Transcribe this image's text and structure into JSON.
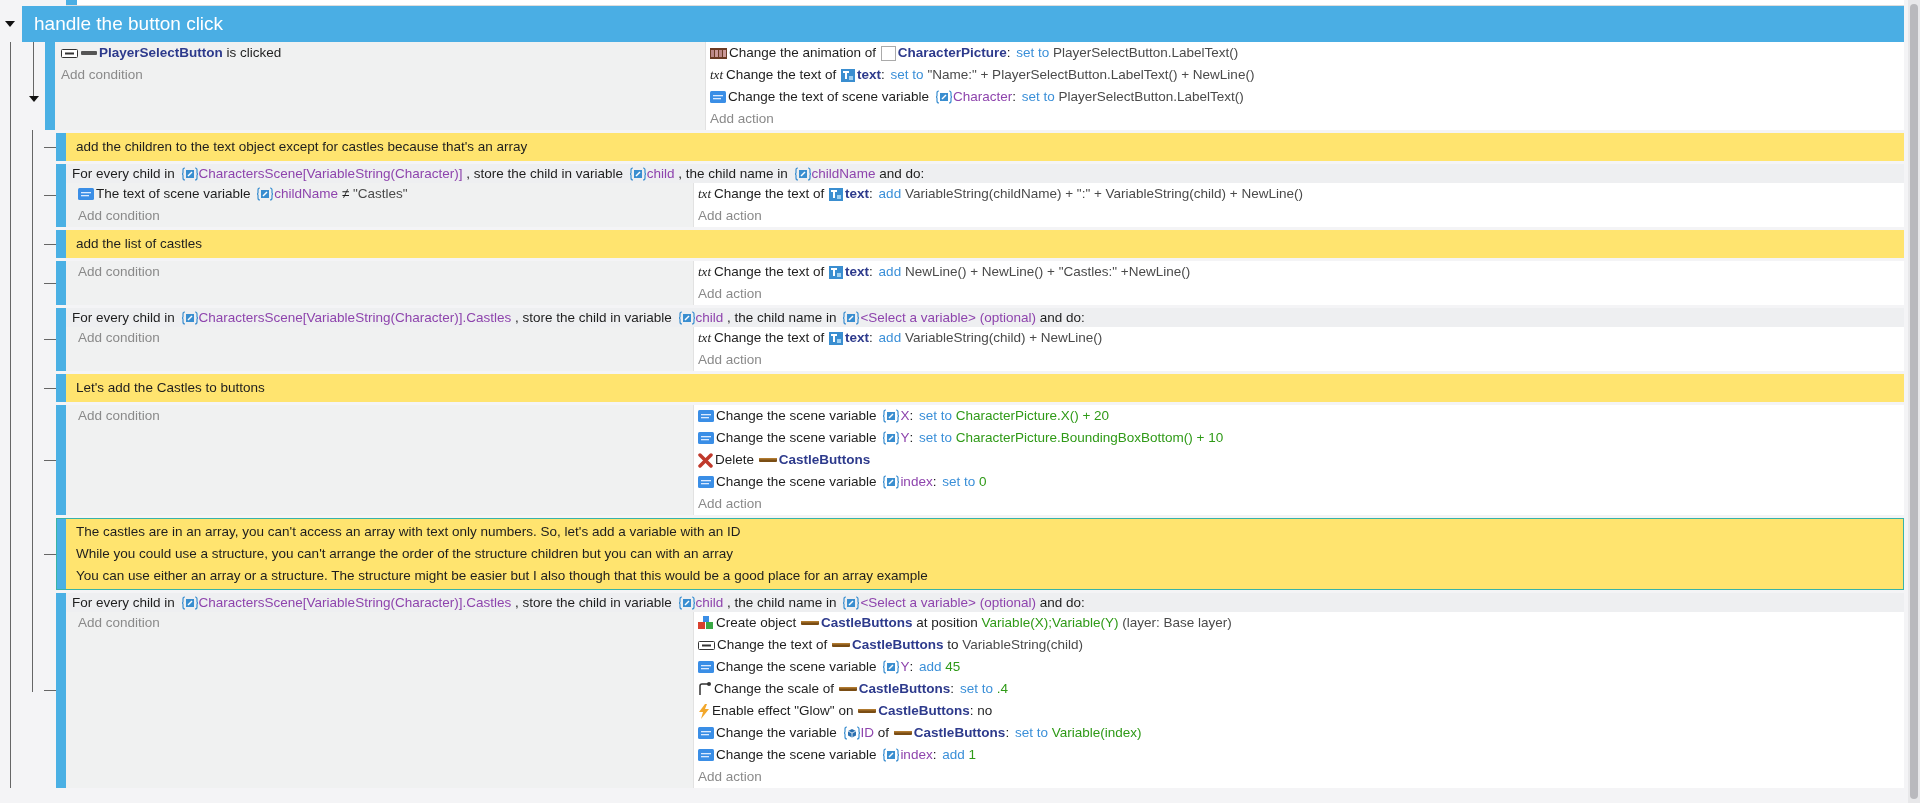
{
  "group": {
    "title": "handle the button click",
    "expanded": true
  },
  "events": [
    {
      "kind": "standard",
      "selected": false,
      "expanded": true,
      "conditions": [
        {
          "kind": "button",
          "parts": [
            {
              "kind": "button-object",
              "text": "PlayerSelectButton"
            },
            {
              "kind": "plain",
              "text": " is clicked"
            }
          ]
        }
      ],
      "add_condition": "Add condition",
      "actions": [
        {
          "kind": "animation",
          "parts": [
            {
              "kind": "plain",
              "text": "Change the animation of "
            },
            {
              "kind": "sprite-object",
              "text": "CharacterPicture"
            },
            {
              "kind": "plain",
              "text": ": "
            },
            {
              "kind": "op",
              "text": "set to "
            },
            {
              "kind": "expr",
              "text": "PlayerSelectButton.LabelText()"
            }
          ]
        },
        {
          "kind": "text",
          "glyph": "txt",
          "parts": [
            {
              "kind": "plain",
              "text": "Change the text of "
            },
            {
              "kind": "text-object",
              "text": "text"
            },
            {
              "kind": "plain",
              "text": ": "
            },
            {
              "kind": "op",
              "text": "set to "
            },
            {
              "kind": "expr",
              "text": "\"Name:\" + PlayerSelectButton.LabelText() + NewLine()"
            }
          ]
        },
        {
          "kind": "variable",
          "parts": [
            {
              "kind": "plain",
              "text": "Change the text of scene variable "
            },
            {
              "kind": "scene-variable",
              "text": "Character"
            },
            {
              "kind": "plain",
              "text": ": "
            },
            {
              "kind": "op",
              "text": "set to "
            },
            {
              "kind": "expr",
              "text": "PlayerSelectButton.LabelText()"
            }
          ]
        }
      ],
      "add_action": "Add action",
      "children": [
        {
          "kind": "comment",
          "selected": false,
          "lines": [
            "add the children to the text object except for castles because that's an array"
          ]
        },
        {
          "kind": "for-each",
          "selected": false,
          "header": [
            {
              "kind": "plain",
              "text": "For every child in "
            },
            {
              "kind": "scene-variable",
              "text": "CharactersScene[VariableString(Character)]"
            },
            {
              "kind": "plain",
              "text": " , store the child in variable "
            },
            {
              "kind": "scene-variable",
              "text": "child"
            },
            {
              "kind": "plain",
              "text": " , the child name in "
            },
            {
              "kind": "scene-variable",
              "text": "childName"
            },
            {
              "kind": "plain",
              "text": " and do:"
            }
          ],
          "conditions": [
            {
              "kind": "variable",
              "parts": [
                {
                  "kind": "plain",
                  "text": "The text of scene variable "
                },
                {
                  "kind": "scene-variable",
                  "text": "childName"
                },
                {
                  "kind": "plain",
                  "text": " ≠ "
                },
                {
                  "kind": "expr",
                  "text": "\"Castles\""
                }
              ]
            }
          ],
          "add_condition": "Add condition",
          "actions": [
            {
              "kind": "text",
              "glyph": "txt",
              "parts": [
                {
                  "kind": "plain",
                  "text": "Change the text of "
                },
                {
                  "kind": "text-object",
                  "text": "text"
                },
                {
                  "kind": "plain",
                  "text": ": "
                },
                {
                  "kind": "op",
                  "text": "add "
                },
                {
                  "kind": "expr",
                  "text": "VariableString(childName) + \":\" + VariableString(child) + NewLine()"
                }
              ]
            }
          ],
          "add_action": "Add action"
        },
        {
          "kind": "comment",
          "selected": false,
          "lines": [
            "add the list of castles"
          ]
        },
        {
          "kind": "standard",
          "selected": false,
          "add_condition": "Add condition",
          "actions": [
            {
              "kind": "text",
              "glyph": "txt",
              "parts": [
                {
                  "kind": "plain",
                  "text": "Change the text of "
                },
                {
                  "kind": "text-object",
                  "text": "text"
                },
                {
                  "kind": "plain",
                  "text": ": "
                },
                {
                  "kind": "op",
                  "text": "add "
                },
                {
                  "kind": "expr",
                  "text": "NewLine() + NewLine() + \"Castles:\" +NewLine()"
                }
              ]
            }
          ],
          "add_action": "Add action"
        },
        {
          "kind": "for-each",
          "selected": false,
          "header": [
            {
              "kind": "plain",
              "text": "For every child in "
            },
            {
              "kind": "scene-variable",
              "text": "CharactersScene[VariableString(Character)].Castles"
            },
            {
              "kind": "plain",
              "text": " , store the child in variable "
            },
            {
              "kind": "scene-variable",
              "text": "child"
            },
            {
              "kind": "plain",
              "text": " , the child name in "
            },
            {
              "kind": "scene-variable",
              "text": "<Select a variable> (optional)"
            },
            {
              "kind": "plain",
              "text": " and do:"
            }
          ],
          "add_condition": "Add condition",
          "actions": [
            {
              "kind": "text",
              "glyph": "txt",
              "parts": [
                {
                  "kind": "plain",
                  "text": "Change the text of "
                },
                {
                  "kind": "text-object",
                  "text": "text"
                },
                {
                  "kind": "plain",
                  "text": ": "
                },
                {
                  "kind": "op",
                  "text": "add "
                },
                {
                  "kind": "expr",
                  "text": "VariableString(child) + NewLine()"
                }
              ]
            }
          ],
          "add_action": "Add action"
        },
        {
          "kind": "comment",
          "selected": false,
          "lines": [
            "Let's add the Castles to buttons"
          ]
        },
        {
          "kind": "standard",
          "selected": false,
          "add_condition": "Add condition",
          "actions": [
            {
              "kind": "variable",
              "parts": [
                {
                  "kind": "plain",
                  "text": "Change the scene variable "
                },
                {
                  "kind": "scene-variable",
                  "text": "X"
                },
                {
                  "kind": "plain",
                  "text": ": "
                },
                {
                  "kind": "op",
                  "text": "set to "
                },
                {
                  "kind": "value",
                  "text": "CharacterPicture.X() + 20"
                }
              ]
            },
            {
              "kind": "variable",
              "parts": [
                {
                  "kind": "plain",
                  "text": "Change the scene variable "
                },
                {
                  "kind": "scene-variable",
                  "text": "Y"
                },
                {
                  "kind": "plain",
                  "text": ": "
                },
                {
                  "kind": "op",
                  "text": "set to "
                },
                {
                  "kind": "value",
                  "text": "CharacterPicture.BoundingBoxBottom() + 10"
                }
              ]
            },
            {
              "kind": "delete",
              "parts": [
                {
                  "kind": "plain",
                  "text": "Delete "
                },
                {
                  "kind": "panel-object",
                  "text": "CastleButtons"
                }
              ]
            },
            {
              "kind": "variable",
              "parts": [
                {
                  "kind": "plain",
                  "text": "Change the scene variable "
                },
                {
                  "kind": "scene-variable",
                  "text": "index"
                },
                {
                  "kind": "plain",
                  "text": ": "
                },
                {
                  "kind": "op",
                  "text": "set to "
                },
                {
                  "kind": "value",
                  "text": "0"
                }
              ]
            }
          ],
          "add_action": "Add action"
        },
        {
          "kind": "comment",
          "selected": true,
          "lines": [
            "The castles are in an array, you can't access an array with text only numbers. So, let's add a variable with an ID",
            "While you could use a structure, you can't arrange the order of the structure children but you can with an array",
            "You can use either an array or a structure. The structure might be easier but I also though that this would be a good place for an array example"
          ]
        },
        {
          "kind": "for-each",
          "selected": false,
          "header": [
            {
              "kind": "plain",
              "text": "For every child in "
            },
            {
              "kind": "scene-variable",
              "text": "CharactersScene[VariableString(Character)].Castles"
            },
            {
              "kind": "plain",
              "text": " , store the child in variable "
            },
            {
              "kind": "scene-variable",
              "text": "child"
            },
            {
              "kind": "plain",
              "text": " , the child name in "
            },
            {
              "kind": "scene-variable",
              "text": "<Select a variable> (optional)"
            },
            {
              "kind": "plain",
              "text": " and do:"
            }
          ],
          "add_condition": "Add condition",
          "actions": [
            {
              "kind": "create",
              "parts": [
                {
                  "kind": "plain",
                  "text": "Create object "
                },
                {
                  "kind": "panel-object",
                  "text": "CastleButtons"
                },
                {
                  "kind": "plain",
                  "text": " at position "
                },
                {
                  "kind": "value",
                  "text": "Variable(X);Variable(Y)"
                },
                {
                  "kind": "expr",
                  "text": " (layer: Base layer)"
                }
              ]
            },
            {
              "kind": "button",
              "parts": [
                {
                  "kind": "plain",
                  "text": "Change the text of "
                },
                {
                  "kind": "panel-object",
                  "text": "CastleButtons"
                },
                {
                  "kind": "plain",
                  "text": " to "
                },
                {
                  "kind": "expr",
                  "text": "VariableString(child)"
                }
              ]
            },
            {
              "kind": "variable",
              "parts": [
                {
                  "kind": "plain",
                  "text": "Change the scene variable "
                },
                {
                  "kind": "scene-variable",
                  "text": "Y"
                },
                {
                  "kind": "plain",
                  "text": ": "
                },
                {
                  "kind": "op",
                  "text": "add "
                },
                {
                  "kind": "value",
                  "text": "45"
                }
              ]
            },
            {
              "kind": "scale",
              "parts": [
                {
                  "kind": "plain",
                  "text": "Change the scale of "
                },
                {
                  "kind": "panel-object",
                  "text": "CastleButtons"
                },
                {
                  "kind": "plain",
                  "text": ": "
                },
                {
                  "kind": "op",
                  "text": "set to "
                },
                {
                  "kind": "value",
                  "text": ".4"
                }
              ]
            },
            {
              "kind": "effect",
              "parts": [
                {
                  "kind": "plain",
                  "text": "Enable effect \"Glow\" on "
                },
                {
                  "kind": "panel-object",
                  "text": "CastleButtons"
                },
                {
                  "kind": "plain",
                  "text": ": no"
                }
              ]
            },
            {
              "kind": "variable",
              "parts": [
                {
                  "kind": "plain",
                  "text": "Change the variable "
                },
                {
                  "kind": "object-variable",
                  "text": "ID"
                },
                {
                  "kind": "plain",
                  "text": " of "
                },
                {
                  "kind": "panel-object",
                  "text": "CastleButtons"
                },
                {
                  "kind": "plain",
                  "text": ": "
                },
                {
                  "kind": "op",
                  "text": "set to "
                },
                {
                  "kind": "value",
                  "text": "Variable(index)"
                }
              ]
            },
            {
              "kind": "variable",
              "parts": [
                {
                  "kind": "plain",
                  "text": "Change the scene variable "
                },
                {
                  "kind": "scene-variable",
                  "text": "index"
                },
                {
                  "kind": "plain",
                  "text": ": "
                },
                {
                  "kind": "op",
                  "text": "add "
                },
                {
                  "kind": "value",
                  "text": "1"
                }
              ]
            }
          ],
          "add_action": "Add action"
        }
      ]
    }
  ]
}
